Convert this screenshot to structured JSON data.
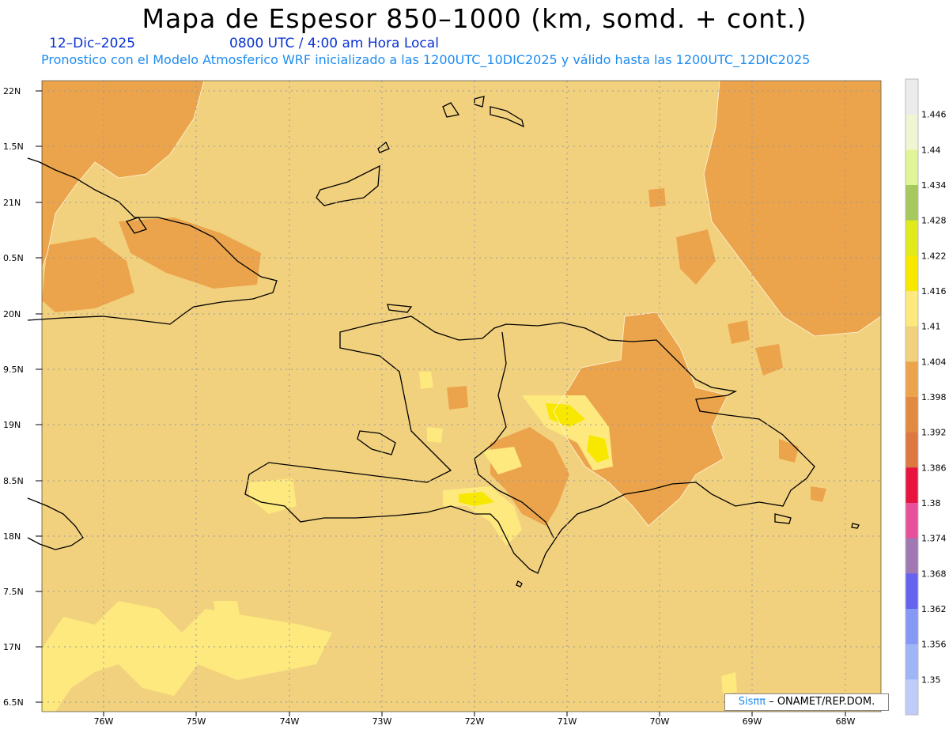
{
  "header": {
    "title": "Mapa de Espesor 850–1000 (km, somd. + cont.)",
    "date": "12–Dic–2025",
    "time": "0800 UTC / 4:00 am Hora Local",
    "forecast": "Pronostico con el Modelo Atmosferico WRF inicializado a las 1200UTC_10DIC2025 y válido hasta las  1200UTC_12DIC2025"
  },
  "axes": {
    "lat_labels": [
      "22N",
      "1.5N",
      "21N",
      "0.5N",
      "20N",
      "9.5N",
      "19N",
      "8.5N",
      "18N",
      "7.5N",
      "17N",
      "6.5N"
    ],
    "lon_labels": [
      "76W",
      "75W",
      "74W",
      "73W",
      "72W",
      "71W",
      "70W",
      "69W",
      "68W"
    ]
  },
  "colorbar": {
    "labels": [
      "1.446",
      "1.44",
      "1.434",
      "1.428",
      "1.422",
      "1.416",
      "1.41",
      "1.404",
      "1.398",
      "1.392",
      "1.386",
      "1.38",
      "1.374",
      "1.368",
      "1.362",
      "1.356",
      "1.35"
    ],
    "colors_top_to_bottom": [
      "#ececec",
      "#f2f5d4",
      "#dff598",
      "#a6c95e",
      "#e0ea1c",
      "#f8e800",
      "#fde97e",
      "#f2d17e",
      "#eca44c",
      "#e48a40",
      "#dc7840",
      "#e81440",
      "#e8509c",
      "#a078b4",
      "#6464f0",
      "#8498f4",
      "#a0b4f8",
      "#c0ccf8"
    ]
  },
  "map": {
    "fill_colors": {
      "base": "#f2d17e",
      "warm_low": "#eca44c",
      "low": "#e48a40",
      "high": "#fde97e",
      "highest": "#f8e800"
    },
    "coast_color": "#000000",
    "grid": "dotted"
  },
  "credit": {
    "brand": "Sisππ",
    "text": " – ONAMET/REP.DOM."
  }
}
